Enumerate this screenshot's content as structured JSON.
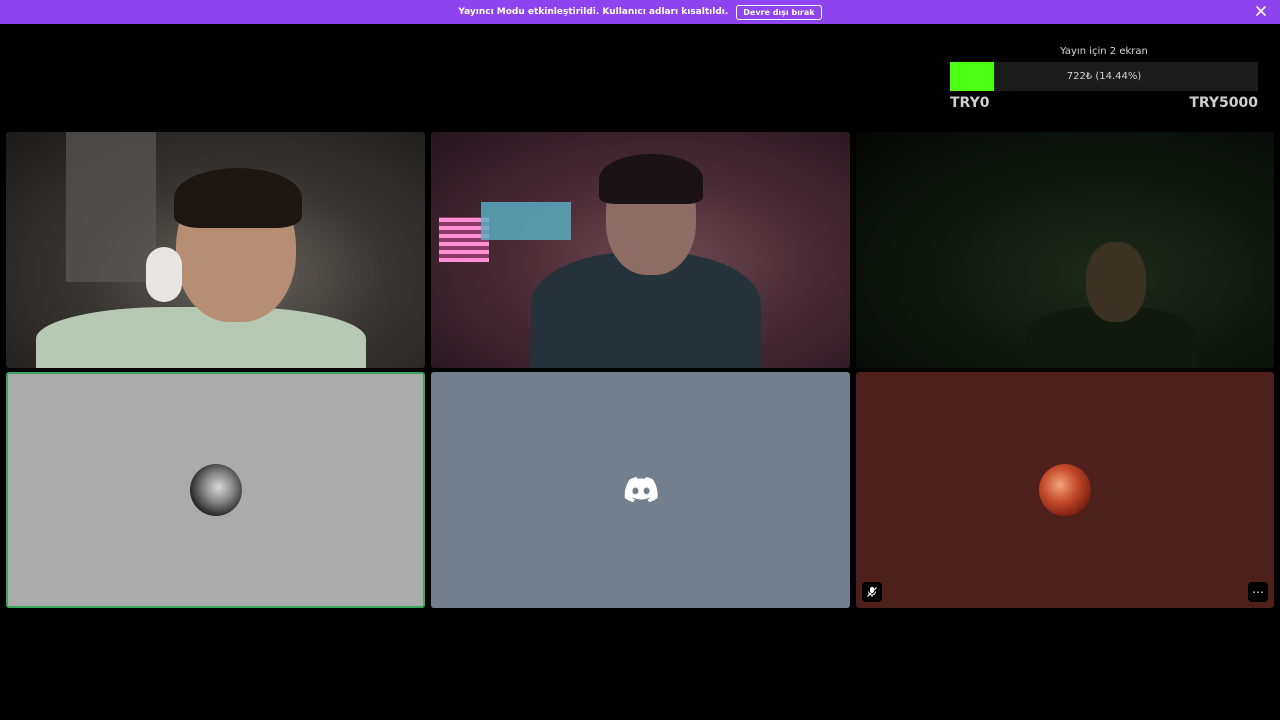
{
  "banner": {
    "message": "Yayıncı Modu etkinleştirildi. Kullanıcı adları kısaltıldı.",
    "disable_label": "Devre dışı bırak",
    "close_icon": "close-icon",
    "color": "#8f44f0"
  },
  "goal": {
    "title": "Yayın için 2 ekran",
    "progress_text": "722₺ (14.44%)",
    "progress_percent": 14.44,
    "min_label": "TRY0",
    "max_label": "TRY5000",
    "fill_color": "#4cff14"
  },
  "tiles": [
    {
      "kind": "video"
    },
    {
      "kind": "video"
    },
    {
      "kind": "video"
    },
    {
      "kind": "avatar",
      "speaking": true,
      "background": "#ababab",
      "border": "#3ba55d"
    },
    {
      "kind": "default-avatar",
      "icon": "discord-logo-icon",
      "background": "#747f8d"
    },
    {
      "kind": "avatar",
      "background": "#4d201c",
      "muted": true,
      "icons": [
        "muted-mic-icon",
        "more-options-icon"
      ]
    }
  ]
}
